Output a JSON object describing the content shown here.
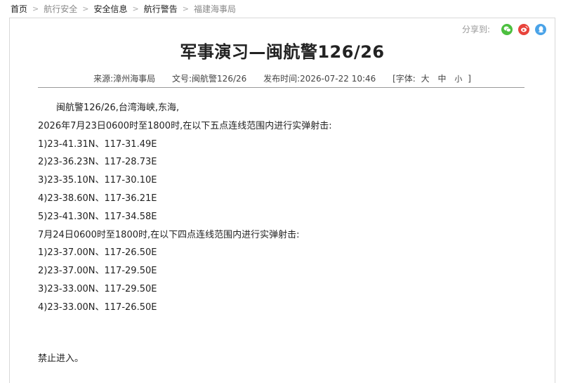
{
  "breadcrumb": [
    "首页",
    "航行安全",
    "安全信息",
    "航行警告",
    "福建海事局"
  ],
  "share": {
    "label": "分享到:",
    "icons": [
      {
        "name": "wechat-icon",
        "color": "#4cbf3f",
        "glyph": "✆"
      },
      {
        "name": "weibo-icon",
        "color": "#e8433b",
        "glyph": "◉"
      },
      {
        "name": "qq-icon",
        "color": "#4aa3e8",
        "glyph": "◆"
      }
    ]
  },
  "article": {
    "title": "军事演习—闽航警126/26",
    "source": "来源:漳州海事局",
    "doc_no": "文号:闽航警126/26",
    "published": "发布时间:2026-07-22 10:46",
    "font_label": "[字体:",
    "font_sizes": [
      "大",
      "中",
      "小"
    ],
    "font_close": "]",
    "lines": [
      "闽航警126/26,台湾海峡,东海,",
      "2026年7月23日0600时至1800时,在以下五点连线范围内进行实弹射击:",
      "1)23-41.31N、117-31.49E",
      "2)23-36.23N、117-28.73E",
      "3)23-35.10N、117-30.10E",
      "4)23-38.60N、117-36.21E",
      "5)23-41.30N、117-34.58E",
      "7月24日0600时至1800时,在以下四点连线范围内进行实弹射击:",
      "1)23-37.00N、117-26.50E",
      "2)23-37.00N、117-29.50E",
      "3)23-33.00N、117-29.50E",
      "4)23-33.00N、117-26.50E"
    ],
    "closing": "禁止进入。"
  }
}
